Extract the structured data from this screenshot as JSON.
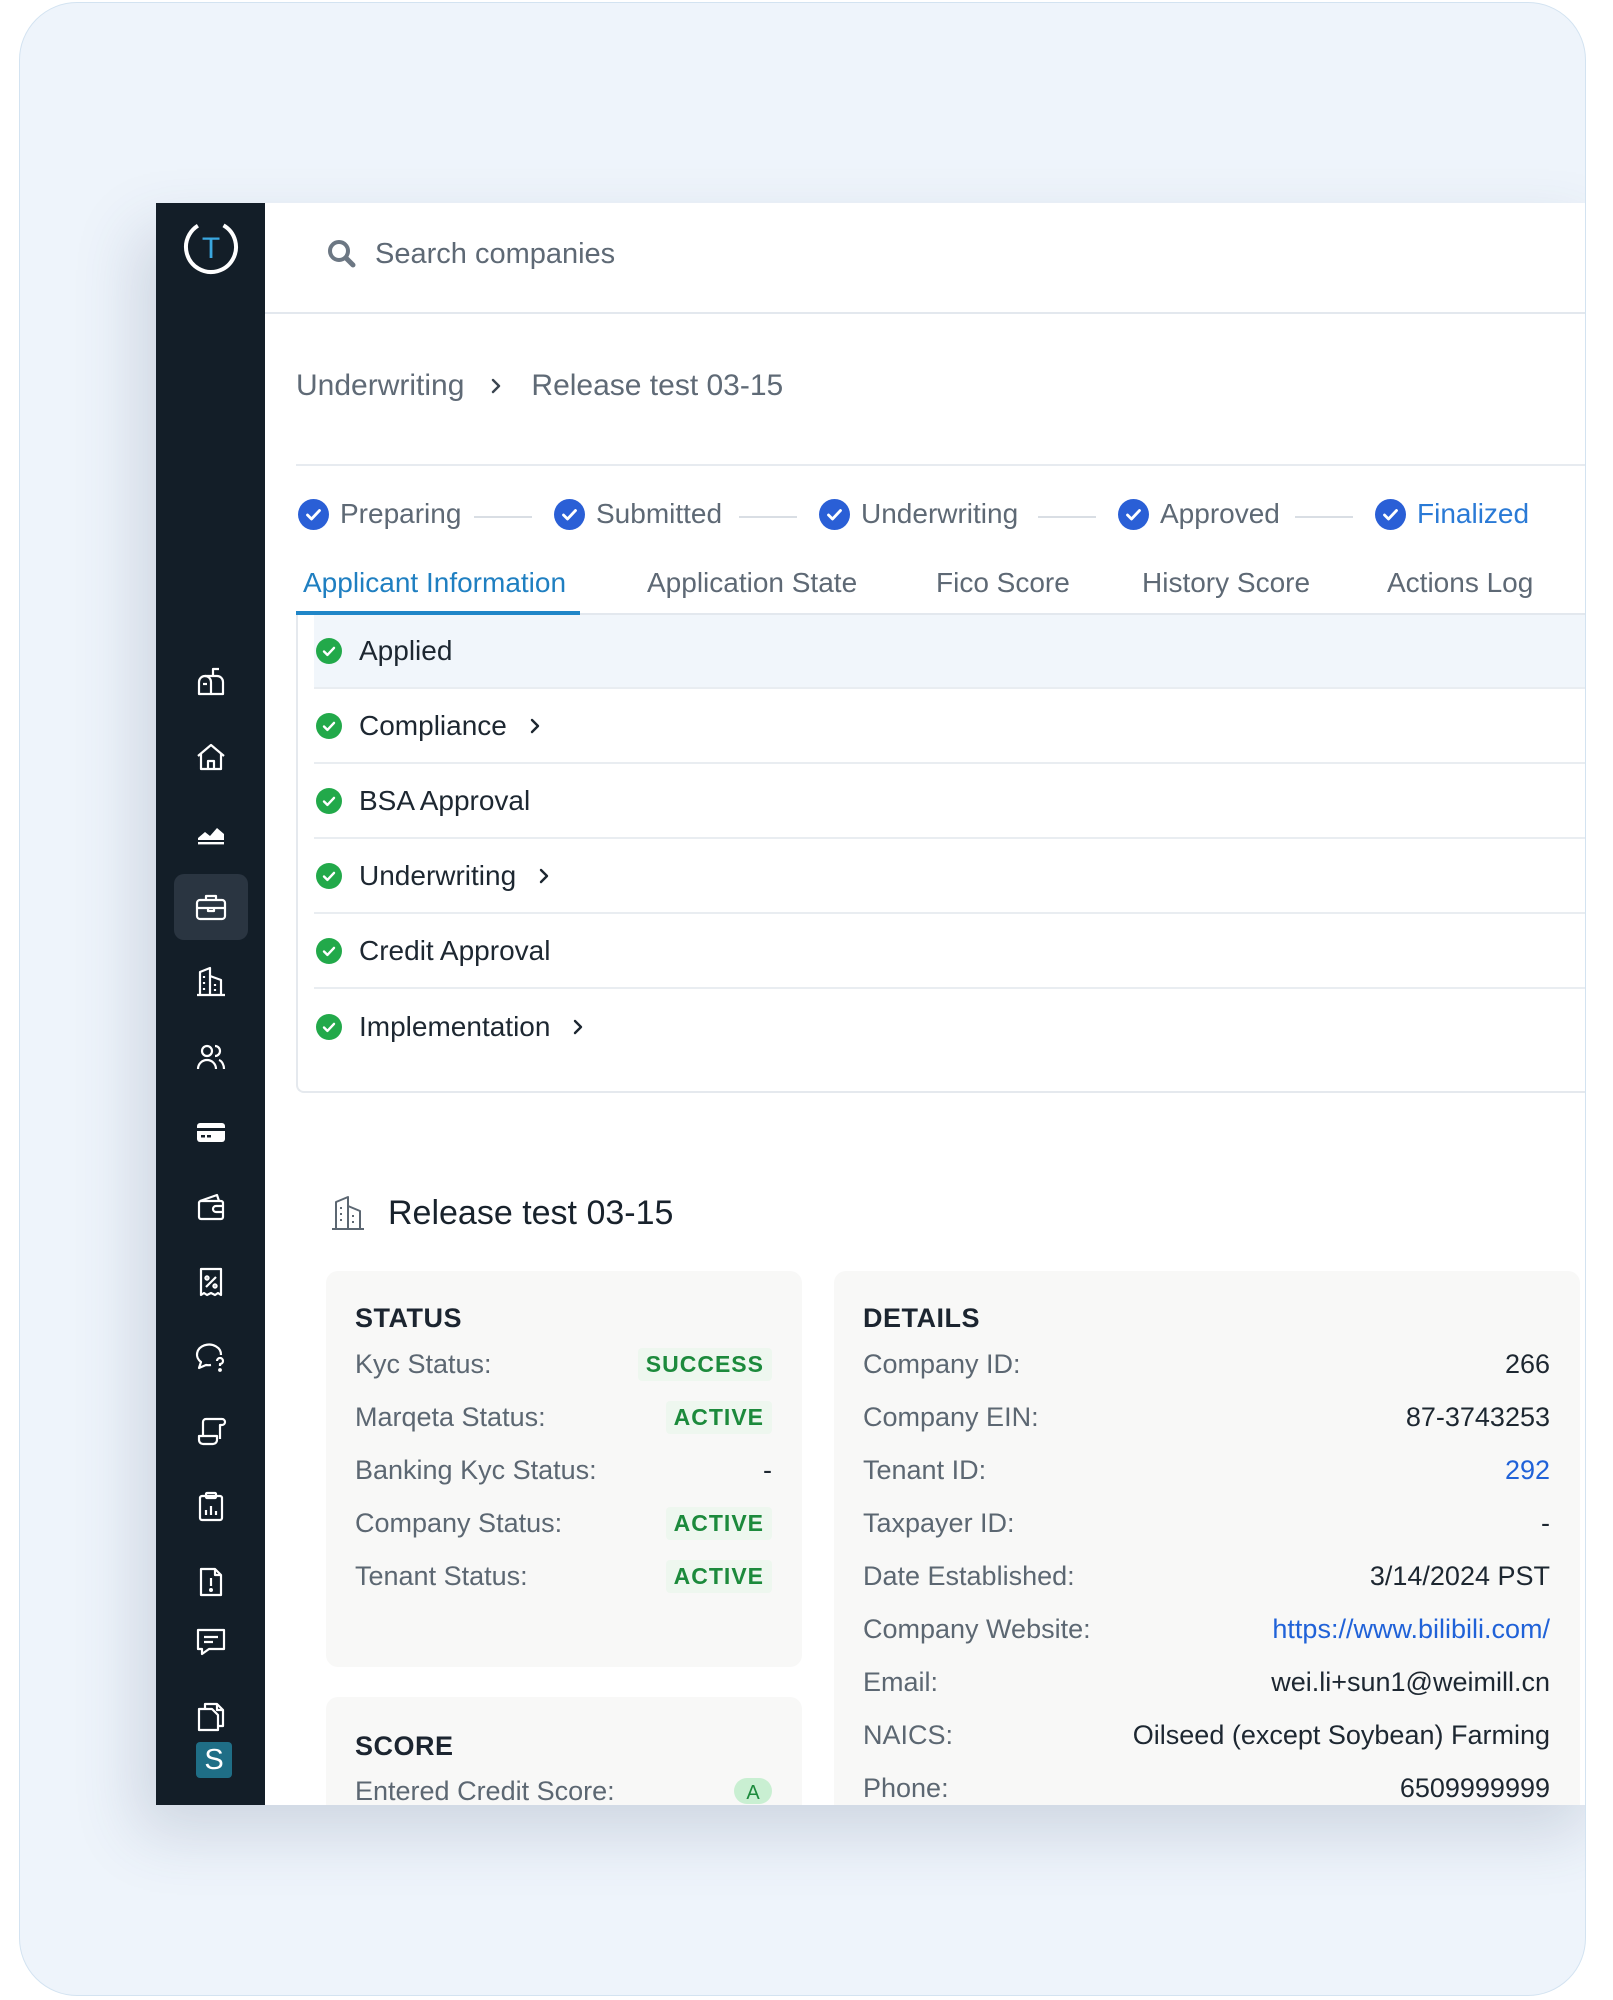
{
  "logo_letter": "T",
  "search": {
    "placeholder": "Search companies"
  },
  "breadcrumb": {
    "parent": "Underwriting",
    "current": "Release test 03-15"
  },
  "stepper": [
    {
      "label": "Preparing"
    },
    {
      "label": "Submitted"
    },
    {
      "label": "Underwriting"
    },
    {
      "label": "Approved"
    },
    {
      "label": "Finalized"
    }
  ],
  "tabs": [
    {
      "label": "Applicant Information"
    },
    {
      "label": "Application State"
    },
    {
      "label": "Fico Score"
    },
    {
      "label": "History Score"
    },
    {
      "label": "Actions Log"
    }
  ],
  "active_tab": "Applicant Information",
  "checklist": [
    {
      "label": "Applied",
      "expandable": false
    },
    {
      "label": "Compliance",
      "expandable": true
    },
    {
      "label": "BSA Approval",
      "expandable": false
    },
    {
      "label": "Underwriting",
      "expandable": true
    },
    {
      "label": "Credit Approval",
      "expandable": false
    },
    {
      "label": "Implementation",
      "expandable": true
    }
  ],
  "company": {
    "name": "Release test 03-15"
  },
  "status": {
    "title": "STATUS",
    "rows": [
      {
        "label": "Kyc Status:",
        "value": "SUCCESS"
      },
      {
        "label": "Marqeta Status:",
        "value": "ACTIVE"
      },
      {
        "label": "Banking Kyc Status:",
        "value": "-"
      },
      {
        "label": "Company Status:",
        "value": "ACTIVE"
      },
      {
        "label": "Tenant Status:",
        "value": "ACTIVE"
      }
    ]
  },
  "score": {
    "title": "SCORE",
    "rows": [
      {
        "label": "Entered Credit Score:",
        "value": "A"
      }
    ]
  },
  "details": {
    "title": "DETAILS",
    "rows": [
      {
        "label": "Company ID:",
        "value": "266"
      },
      {
        "label": "Company EIN:",
        "value": "87-3743253"
      },
      {
        "label": "Tenant ID:",
        "value": "292"
      },
      {
        "label": "Taxpayer ID:",
        "value": "-"
      },
      {
        "label": "Date Established:",
        "value": "3/14/2024 PST"
      },
      {
        "label": "Company Website:",
        "value": "https://www.bilibili.com/"
      },
      {
        "label": "Email:",
        "value": "wei.li+sun1@weimill.cn"
      },
      {
        "label": "NAICS:",
        "value": "Oilseed (except Soybean) Farming"
      },
      {
        "label": "Phone:",
        "value": "6509999999"
      }
    ]
  },
  "user_initial": "S",
  "colors": {
    "sidebar": "#131e28",
    "accent": "#2086c8",
    "step_check": "#2a5fd6",
    "success_green": "#1c8a3c",
    "link": "#2062d8"
  },
  "sidebar_icons": [
    "mailbox-icon",
    "home-icon",
    "chart-area-icon",
    "briefcase-icon",
    "building-icon",
    "users-icon",
    "credit-card-icon",
    "wallet-icon",
    "receipt-percent-icon",
    "chat-question-icon",
    "scroll-icon",
    "clipboard-chart-icon",
    "document-alert-icon",
    "message-icon",
    "copy-icon"
  ]
}
